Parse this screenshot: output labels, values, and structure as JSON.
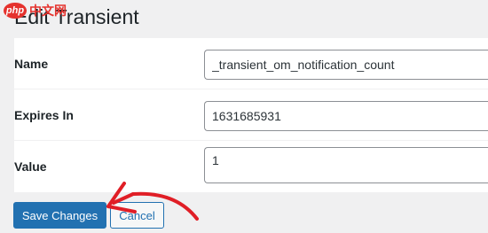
{
  "watermark": {
    "logo": "php",
    "text": "中文网"
  },
  "page": {
    "title": "Edit Transient"
  },
  "form": {
    "rows": [
      {
        "label": "Name",
        "value": "_transient_om_notification_count"
      },
      {
        "label": "Expires In",
        "value": "1631685931"
      },
      {
        "label": "Value",
        "value": "1"
      }
    ]
  },
  "actions": {
    "save_label": "Save Changes",
    "cancel_label": "Cancel"
  },
  "annotation": {
    "color": "#e01e26"
  }
}
